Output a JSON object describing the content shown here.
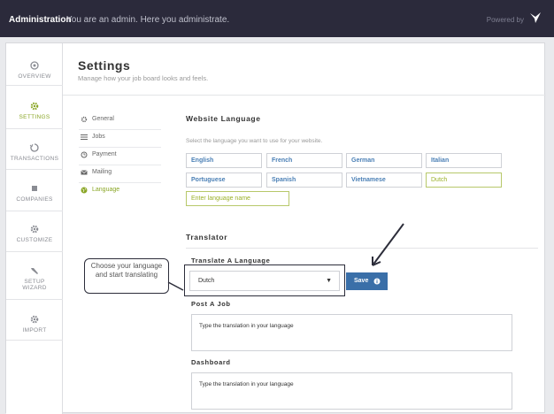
{
  "topbar": {
    "title": "Administration",
    "subtitle": "You are an admin. Here you administrate.",
    "powered_by": "Powered by"
  },
  "sidebar": {
    "items": [
      {
        "label": "OVERVIEW",
        "icon": "overview-icon"
      },
      {
        "label": "SETTINGS",
        "icon": "gear-icon",
        "active": true
      },
      {
        "label": "TRANSACTIONS",
        "icon": "transactions-icon"
      },
      {
        "label": "COMPANIES",
        "icon": "building-icon"
      },
      {
        "label": "CUSTOMIZE",
        "icon": "gear-icon"
      },
      {
        "label": "SETUP",
        "label2": "WIZARD",
        "icon": "wrench-icon"
      },
      {
        "label": "IMPORT",
        "icon": "gear-icon"
      }
    ],
    "accent": "#8aa626"
  },
  "page": {
    "title": "Settings",
    "subtitle": "Manage how your job board looks and feels."
  },
  "tabs": [
    {
      "label": "General",
      "icon": "gear-icon"
    },
    {
      "label": "Jobs",
      "icon": "list-icon"
    },
    {
      "label": "Payment",
      "icon": "clock-icon"
    },
    {
      "label": "Mailing",
      "icon": "envelope-icon"
    },
    {
      "label": "Language",
      "icon": "globe-icon",
      "active": true
    }
  ],
  "website_language": {
    "title": "Website Language",
    "note": "Select the language you want to use for your website.",
    "languages": [
      "English",
      "French",
      "German",
      "Italian",
      "Portuguese",
      "Spanish",
      "Vietnamese",
      "Dutch"
    ],
    "selected": "Dutch",
    "input_placeholder": "Enter language name"
  },
  "translator": {
    "title": "Translator",
    "translate_label": "Translate A Language",
    "selected_language": "Dutch",
    "save_label": "Save",
    "post_job_label": "Post A Job",
    "post_job_placeholder": "Type the translation in your language",
    "dashboard_label": "Dashboard",
    "dashboard_placeholder": "Type the translation in your language"
  },
  "annotation": {
    "callout_text": "Choose your language and start translating"
  },
  "colors": {
    "topbar": "#2b2a3b",
    "accent_green": "#8aa626",
    "save_blue": "#3a6fa8",
    "link_blue": "#4a7fb5"
  }
}
